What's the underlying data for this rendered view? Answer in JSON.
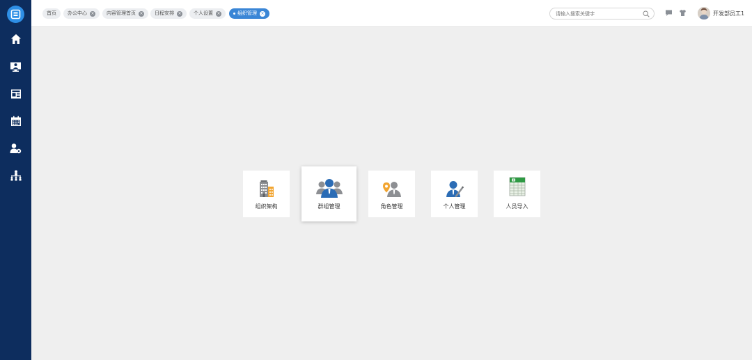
{
  "tabs": [
    {
      "label": "首页",
      "closable": false
    },
    {
      "label": "办公中心",
      "closable": true
    },
    {
      "label": "内容管理首页",
      "closable": true
    },
    {
      "label": "日程安排",
      "closable": true
    },
    {
      "label": "个人设置",
      "closable": true
    },
    {
      "label": "组织管理",
      "closable": true,
      "active": true
    }
  ],
  "search": {
    "placeholder": "请输入搜索关键字"
  },
  "user": {
    "name": "开发部员工1"
  },
  "sidebar": {
    "items": [
      {
        "icon": "home-icon"
      },
      {
        "icon": "monitor-user-icon"
      },
      {
        "icon": "news-icon"
      },
      {
        "icon": "calendar-icon"
      },
      {
        "icon": "user-settings-icon"
      },
      {
        "icon": "org-chart-icon"
      }
    ]
  },
  "cards": [
    {
      "label": "组织架构",
      "icon": "building-icon"
    },
    {
      "label": "群组管理",
      "icon": "group-icon"
    },
    {
      "label": "角色管理",
      "icon": "role-icon"
    },
    {
      "label": "个人管理",
      "icon": "personal-icon"
    },
    {
      "label": "人员导入",
      "icon": "spreadsheet-import-icon"
    }
  ],
  "colors": {
    "sidebar": "#0d2d5e",
    "accent": "#3a86d6",
    "background": "#efefef"
  }
}
